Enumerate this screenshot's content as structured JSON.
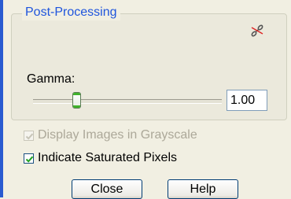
{
  "group": {
    "title": "Post-Processing",
    "link_icon": "broken-link-icon"
  },
  "gamma": {
    "label": "Gamma:",
    "value": "1.00",
    "slider_fraction": 0.23
  },
  "options": {
    "grayscale_label": "Display Images in Grayscale",
    "grayscale_checked": true,
    "grayscale_enabled": false,
    "saturated_label": "Indicate Saturated Pixels",
    "saturated_checked": true
  },
  "buttons": {
    "close_label": "Close",
    "help_label": "Help"
  },
  "colors": {
    "accent_blue": "#1f55dd",
    "check_green": "#21a121",
    "disabled_text": "#aca899"
  }
}
